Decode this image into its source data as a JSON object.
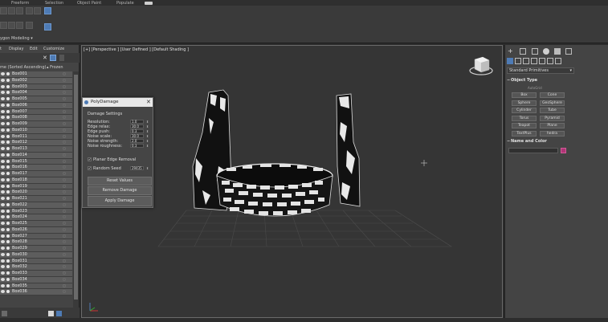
{
  "ribbon": {
    "tabs": [
      "Freeform",
      "Selection",
      "Object Paint",
      "Populate"
    ],
    "polygon_modeling": "ygon Modeling"
  },
  "explorer": {
    "menu": [
      "t",
      "Display",
      "Edit",
      "Customize"
    ],
    "sort_header": "me (Sorted Ascending)",
    "frozen_header": "Frozen",
    "items": [
      "Box001",
      "Box002",
      "Box003",
      "Box004",
      "Box005",
      "Box006",
      "Box007",
      "Box008",
      "Box009",
      "Box010",
      "Box011",
      "Box012",
      "Box013",
      "Box014",
      "Box015",
      "Box016",
      "Box017",
      "Box018",
      "Box019",
      "Box020",
      "Box021",
      "Box022",
      "Box023",
      "Box024",
      "Box025",
      "Box026",
      "Box027",
      "Box028",
      "Box029",
      "Box030",
      "Box031",
      "Box032",
      "Box033",
      "Box034",
      "Box035",
      "Box036"
    ]
  },
  "viewport": {
    "label": "[+] [Perspective ] [User Defined ] [Default Shading ]"
  },
  "dialog": {
    "title": "PolyDamage",
    "section": "Damage Settings",
    "params": [
      {
        "label": "Resolution:",
        "value": "1.0"
      },
      {
        "label": "Edge relax:",
        "value": "30.0"
      },
      {
        "label": "Edge push:",
        "value": "0.3"
      },
      {
        "label": "Noise scale:",
        "value": "30.0"
      },
      {
        "label": "Noise strength:",
        "value": "2.0"
      },
      {
        "label": "Noise roughness:",
        "value": "0.3"
      }
    ],
    "planar_edge_removal": "Planar Edge Removal",
    "random_seed_label": "Random Seed",
    "random_seed_value": "29435",
    "reset_values": "Reset Values",
    "remove_damage": "Remove Damage",
    "apply_damage": "Apply Damage"
  },
  "command_panel": {
    "dropdown": "Standard Primitives",
    "object_type_header": "Object Type",
    "autogrid": "AutoGrid",
    "primitives": [
      "Box",
      "Cone",
      "Sphere",
      "GeoSphere",
      "Cylinder",
      "Tube",
      "Torus",
      "Pyramid",
      "Teapot",
      "Plane",
      "TextPlus",
      "hedra"
    ],
    "name_color_header": "Name and Color",
    "swatch_color": "#b03576"
  },
  "colors": {
    "accent": "#4e7bb5",
    "viewport_bg": "#353535",
    "panel_bg": "#444444"
  }
}
